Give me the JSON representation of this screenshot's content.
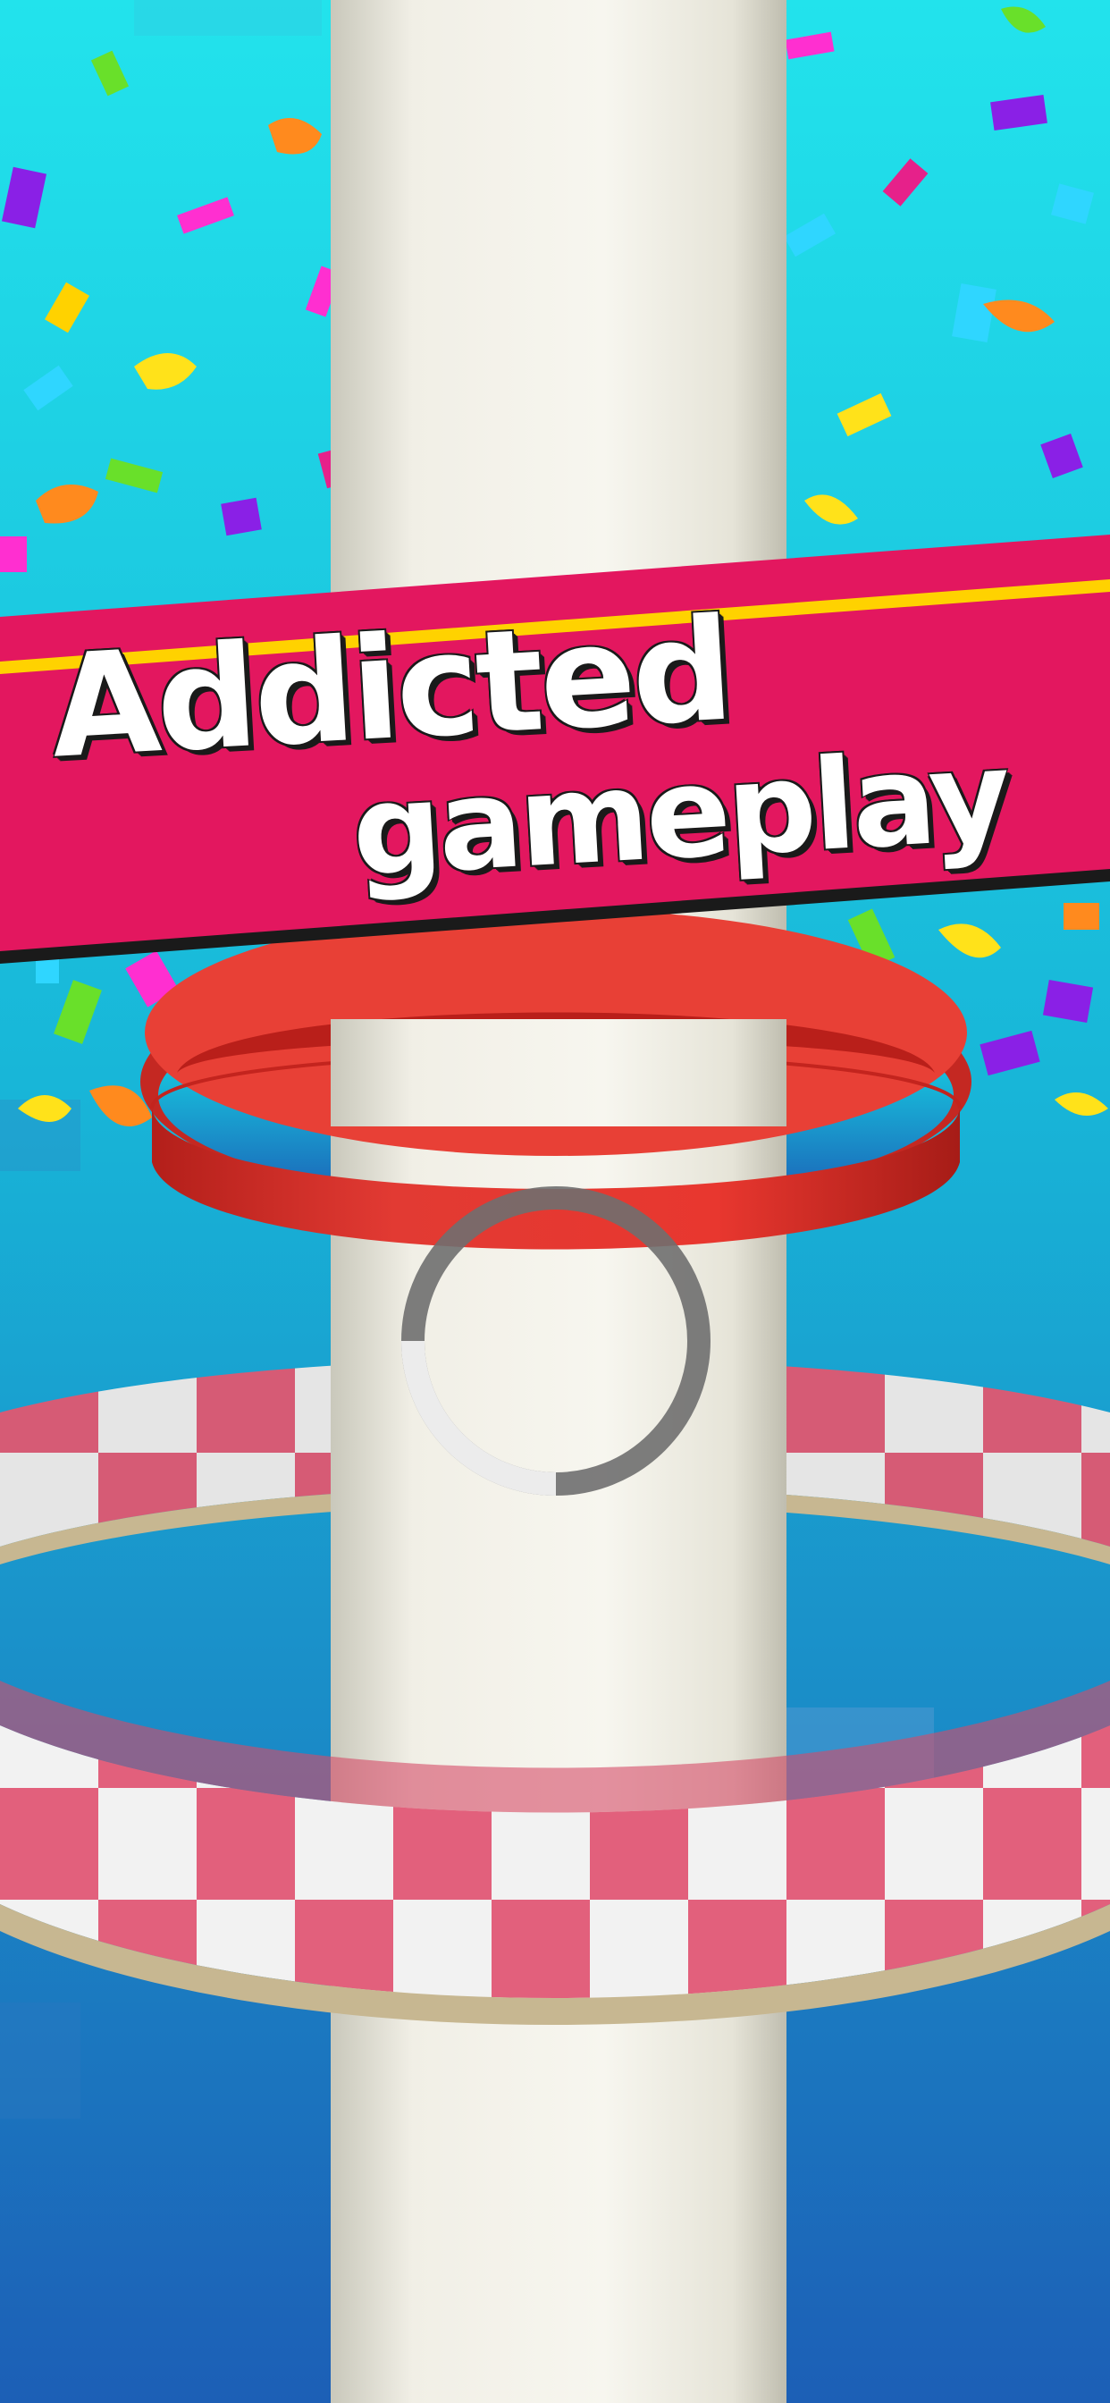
{
  "banner": {
    "line1": "Addicted",
    "line2": "gameplay",
    "color": "#e3175f",
    "stripe_color": "#ffd200"
  },
  "colors": {
    "sky_top": "#22e3ec",
    "sky_bottom": "#1c63b8",
    "pillar": "#f3f1e8",
    "red_ring": "#e4332d",
    "checker_pink": "#ef6683",
    "checker_white": "#ffffff",
    "ball_ring": "#7d7d7d"
  },
  "icons": [
    "confetti",
    "pillar",
    "red-ring",
    "checkered-ring",
    "ball-ring"
  ]
}
